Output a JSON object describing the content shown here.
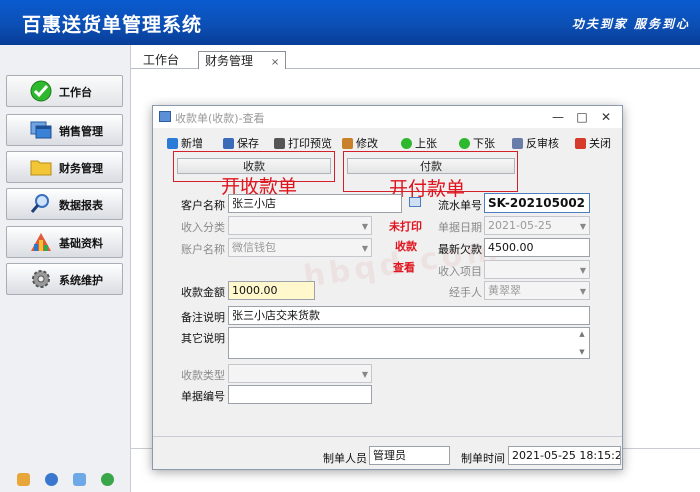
{
  "app": {
    "title": "百惠送货单管理系统",
    "slogan": "功夫到家 服务到心"
  },
  "sidebar": {
    "items": [
      {
        "label": "工作台",
        "icon": "check-circle-icon",
        "color": "#2eb82e"
      },
      {
        "label": "销售管理",
        "icon": "windows-icon",
        "color": "#2f77c9"
      },
      {
        "label": "财务管理",
        "icon": "folder-icon",
        "color": "#f0c030"
      },
      {
        "label": "数据报表",
        "icon": "magnifier-icon",
        "color": "#3a6fc0"
      },
      {
        "label": "基础资料",
        "icon": "chart-icon",
        "color": "#c84a3a"
      },
      {
        "label": "系统维护",
        "icon": "gear-icon",
        "color": "#7a7a7a"
      }
    ]
  },
  "tabs": [
    {
      "label": "工作台"
    },
    {
      "label": "财务管理",
      "close": "×"
    }
  ],
  "dialog": {
    "title": "收款单(收款)-查看",
    "controls": {
      "minimize": "—",
      "maximize": "□",
      "close": "✕"
    },
    "toolbar": {
      "new": "新增",
      "save": "保存",
      "print_preview": "打印预览",
      "edit": "修改",
      "prev": "上张",
      "next": "下张",
      "unaudit": "反审核",
      "close": "关闭"
    },
    "subtabs": {
      "receive": "收款",
      "pay": "付款"
    },
    "annotations": {
      "receive_bill": "开收款单",
      "pay_bill": "开付款单",
      "note_lines": [
        "未打印",
        "收款",
        "查看"
      ],
      "watermark": "hbqd.com"
    },
    "form": {
      "customer_label": "客户名称",
      "customer_value": "张三小店",
      "income_cat_label": "收入分类",
      "account_label": "账户名称",
      "account_value": "微信钱包",
      "amount_label": "收款金额",
      "amount_value": "1000.00",
      "remark_label": "备注说明",
      "remark_value": "张三小店交来货款",
      "other_label": "其它说明",
      "receive_type_label": "收款类型",
      "doc_no_label": "单据编号",
      "serial_label": "流水单号",
      "serial_value": "SK-202105002",
      "date_label": "单据日期",
      "date_value": "2021-05-25",
      "debt_label": "最新欠款",
      "debt_value": "4500.00",
      "income_item_label": "收入项目",
      "handler_label": "经手人",
      "handler_value": "黄翠翠"
    },
    "footer": {
      "maker_label": "制单人员",
      "maker_value": "管理员",
      "time_label": "制单时间",
      "time_value": "2021-05-25 18:15:20"
    }
  }
}
